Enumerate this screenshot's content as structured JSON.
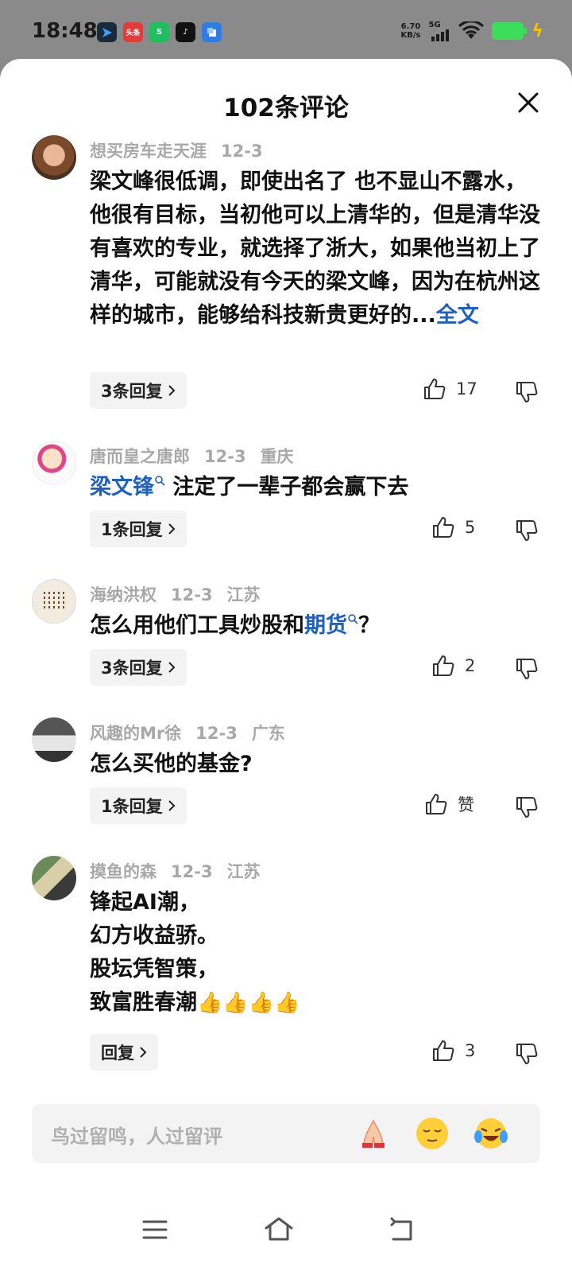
{
  "status_bar": {
    "time": "18:48",
    "apps": [
      {
        "icon": "app-blue-arrow-icon",
        "label": "",
        "color": "#1a2a3a"
      },
      {
        "icon": "app-toutiao-icon",
        "label": "头条",
        "color": "#e23b3b"
      },
      {
        "icon": "app-green-s-icon",
        "label": "S",
        "color": "#1fbf5f"
      },
      {
        "icon": "app-tiktok-icon",
        "label": "♪",
        "color": "#111111"
      },
      {
        "icon": "app-blue-square-icon",
        "label": "",
        "color": "#2f7de1"
      }
    ],
    "net_speed_value": "6.70",
    "net_speed_unit": "KB/s",
    "network": "5G"
  },
  "sheet": {
    "title": "102条评论"
  },
  "comments": [
    {
      "user": "想买房车走天涯",
      "date": "12-3",
      "location": "",
      "text": "梁文峰很低调，即使出名了 也不显山不露水，他很有目标，当初他可以上清华的，但是清华没有喜欢的专业，就选择了浙大，如果他当初上了清华，可能就没有今天的梁文峰，因为在杭州这样的城市，能够给科技新贵更好的...",
      "full_text_link": "全文",
      "reply_label": "3条回复",
      "likes": "17"
    },
    {
      "user": "唐而皇之唐郎",
      "date": "12-3",
      "location": "重庆",
      "text_link": "梁文锋",
      "text": "注定了一辈子都会赢下去",
      "reply_label": "1条回复",
      "likes": "5"
    },
    {
      "user": "海纳洪权",
      "date": "12-3",
      "location": "江苏",
      "text": "怎么用他们工具炒股和",
      "text_link": "期货",
      "text_after": "？",
      "reply_label": "3条回复",
      "likes": "2"
    },
    {
      "user": "风趣的Mr徐",
      "date": "12-3",
      "location": "广东",
      "text": "怎么买他的基金?",
      "reply_label": "1条回复",
      "likes": "赞"
    },
    {
      "user": "摸鱼的森",
      "date": "12-3",
      "location": "江苏",
      "lines": [
        "锋起AI潮，",
        "幻方收益骄。",
        "股坛凭智策，",
        "致富胜春潮"
      ],
      "emoji": "👍👍👍👍",
      "reply_label": "回复",
      "likes": "3"
    }
  ],
  "input": {
    "placeholder": "鸟过留鸣，人过留评",
    "emojis": [
      "folded-hands-icon",
      "relieved-face-icon",
      "laughing-tears-icon"
    ]
  },
  "navbar": {
    "items": [
      "menu-icon",
      "home-icon",
      "back-icon"
    ]
  },
  "colors": {
    "link": "#1f5fbf",
    "meta": "#a8a8a8",
    "battery": "#3ddc5a"
  }
}
